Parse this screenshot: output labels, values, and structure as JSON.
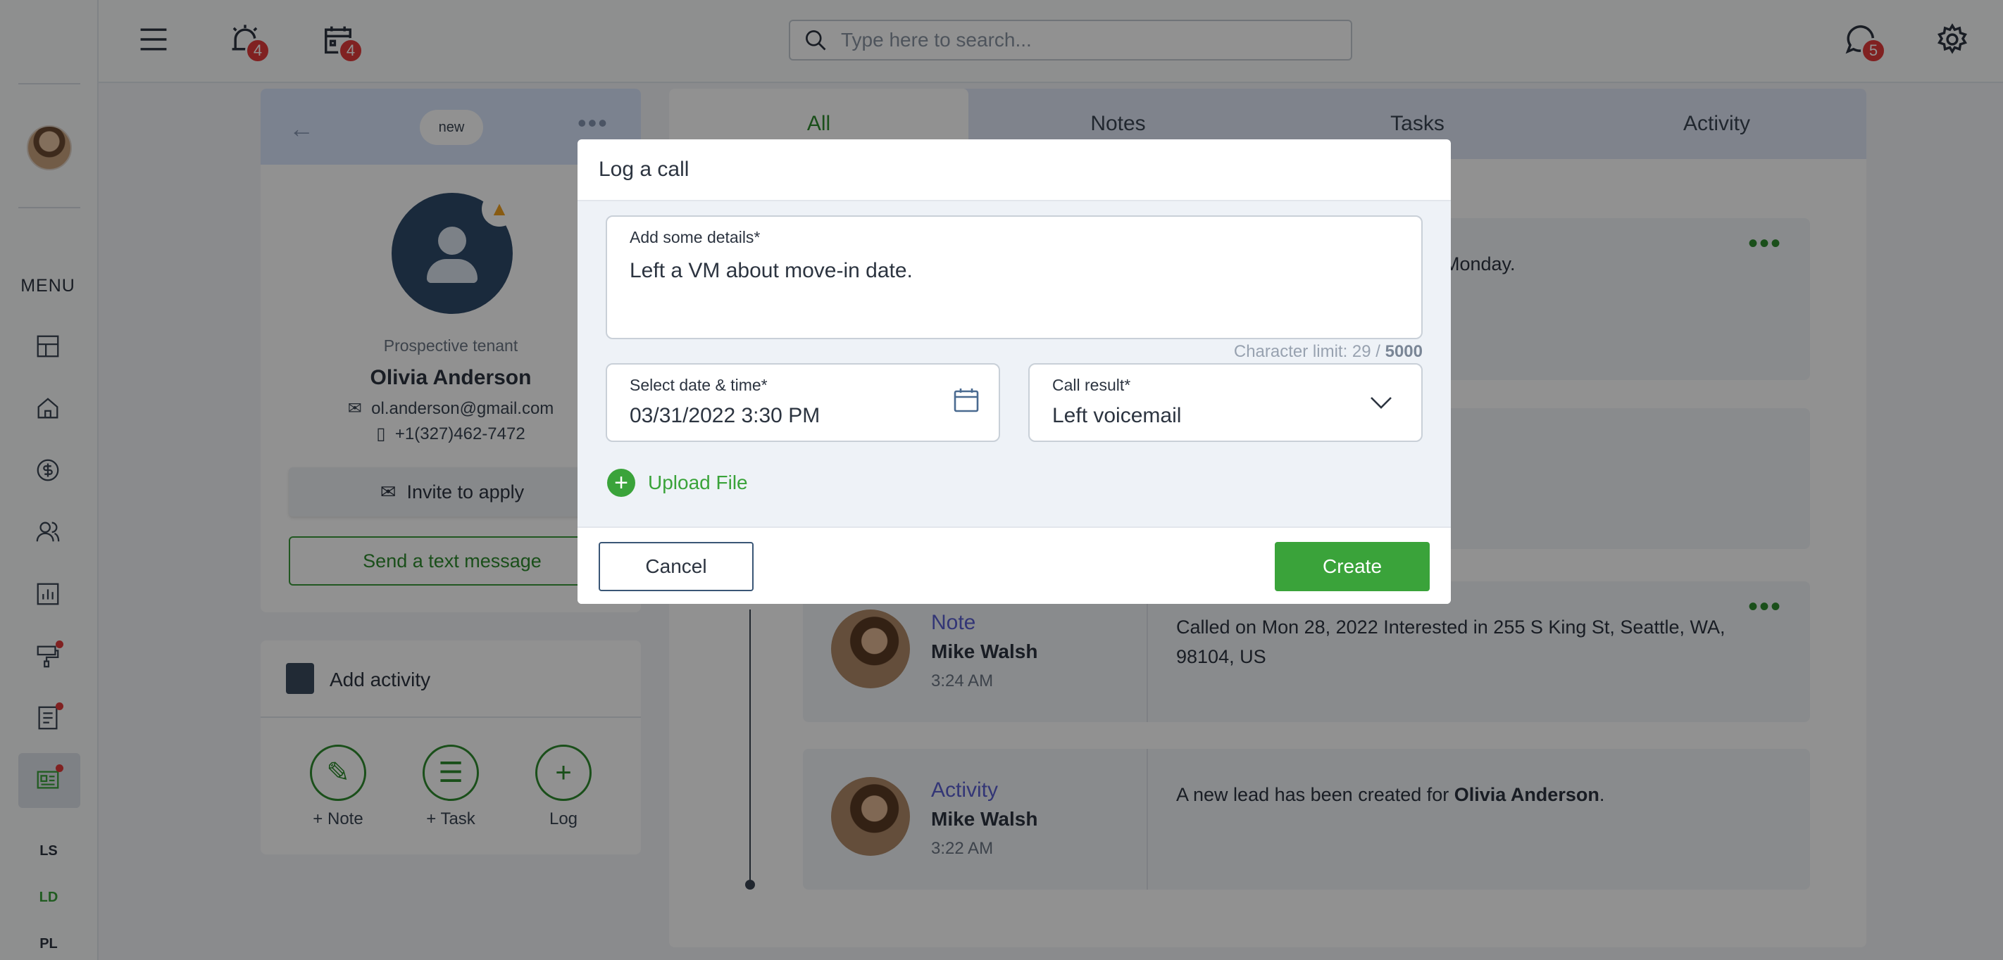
{
  "topbar": {
    "alerts_badge": "4",
    "calendar_badge": "4",
    "messages_badge": "5",
    "search_placeholder": "Type here to search..."
  },
  "sidebar": {
    "menu_label": "MENU",
    "tags": [
      "LS",
      "LD",
      "PL"
    ]
  },
  "lead": {
    "status_pill": "new",
    "type": "Prospective tenant",
    "name": "Olivia Anderson",
    "email": "ol.anderson@gmail.com",
    "phone": "+1(327)462-7472",
    "invite_label": "Invite to apply",
    "text_label": "Send a text message"
  },
  "add_activity": {
    "title": "Add activity",
    "buttons": [
      "+ Note",
      "+ Task",
      "Log"
    ]
  },
  "feed": {
    "tabs": [
      "All",
      "Notes",
      "Tasks",
      "Activity"
    ],
    "item1_partial": "Monday.",
    "note": {
      "type": "Note",
      "who": "Mike Walsh",
      "time": "3:24 AM",
      "body": "Called on Mon 28, 2022 Interested in 255 S King St, Seattle, WA, 98104, US"
    },
    "activity": {
      "type": "Activity",
      "who": "Mike Walsh",
      "time": "3:22 AM",
      "body_prefix": "A new lead has been created for ",
      "body_bold": "Olivia Anderson",
      "body_suffix": "."
    }
  },
  "modal": {
    "title": "Log a call",
    "details_label": "Add some details*",
    "details_value": "Left a VM about move-in date.",
    "char_limit_prefix": "Character limit: 29 / ",
    "char_limit_max": "5000",
    "date_label": "Select date & time*",
    "date_value": "03/31/2022 3:30 PM",
    "result_label": "Call result*",
    "result_value": "Left voicemail",
    "upload_label": "Upload File",
    "cancel_label": "Cancel",
    "create_label": "Create"
  },
  "colors": {
    "accent_green": "#3aa33a",
    "badge_red": "#e23b3b",
    "link_purple": "#5a5fd0"
  }
}
